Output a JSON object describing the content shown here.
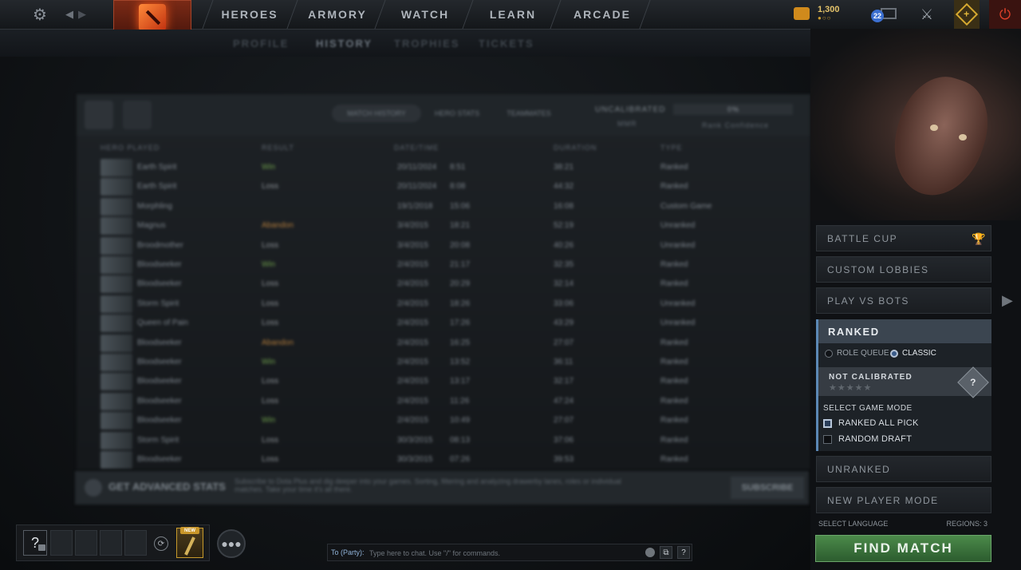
{
  "nav": {
    "items": [
      "HEROES",
      "ARMORY",
      "WATCH",
      "LEARN",
      "ARCADE"
    ]
  },
  "currency": {
    "amount": "1,300",
    "dots": "●○○"
  },
  "notifications": {
    "count": "22"
  },
  "subnav": {
    "items": [
      "PROFILE",
      "HISTORY",
      "TROPHIES",
      "TICKETS"
    ],
    "active": "HISTORY"
  },
  "profile": {
    "tabs": [
      "MATCH HISTORY",
      "HERO STATS",
      "TEAMMATES"
    ],
    "rank_label": "UNCALIBRATED",
    "rank_sub": "MMR",
    "confidence_label": "Rank Confidence",
    "confidence_value": "0%",
    "columns": [
      "HERO PLAYED",
      "RESULT",
      "DATE/TIME",
      "DURATION",
      "TYPE"
    ],
    "matches": [
      {
        "hero": "Earth Spirit",
        "result": "Win",
        "date": "20/11/2024",
        "time": "8:51",
        "duration": "38:21",
        "type": "Ranked"
      },
      {
        "hero": "Earth Spirit",
        "result": "Loss",
        "date": "20/11/2024",
        "time": "8:08",
        "duration": "44:32",
        "type": "Ranked"
      },
      {
        "hero": "Morphling",
        "result": "",
        "date": "19/1/2018",
        "time": "15:06",
        "duration": "16:08",
        "type": "Custom Game"
      },
      {
        "hero": "Magnus",
        "result": "Abandon",
        "date": "3/4/2015",
        "time": "18:21",
        "duration": "52:19",
        "type": "Unranked"
      },
      {
        "hero": "Broodmother",
        "result": "Loss",
        "date": "3/4/2015",
        "time": "20:08",
        "duration": "40:26",
        "type": "Unranked"
      },
      {
        "hero": "Bloodseeker",
        "result": "Win",
        "date": "2/4/2015",
        "time": "21:17",
        "duration": "32:35",
        "type": "Ranked"
      },
      {
        "hero": "Bloodseeker",
        "result": "Loss",
        "date": "2/4/2015",
        "time": "20:29",
        "duration": "32:14",
        "type": "Ranked"
      },
      {
        "hero": "Storm Spirit",
        "result": "Loss",
        "date": "2/4/2015",
        "time": "18:26",
        "duration": "33:06",
        "type": "Unranked"
      },
      {
        "hero": "Queen of Pain",
        "result": "Loss",
        "date": "2/4/2015",
        "time": "17:26",
        "duration": "43:29",
        "type": "Unranked"
      },
      {
        "hero": "Bloodseeker",
        "result": "Abandon",
        "date": "2/4/2015",
        "time": "16:25",
        "duration": "27:07",
        "type": "Ranked"
      },
      {
        "hero": "Bloodseeker",
        "result": "Win",
        "date": "2/4/2015",
        "time": "13:52",
        "duration": "36:11",
        "type": "Ranked"
      },
      {
        "hero": "Bloodseeker",
        "result": "Loss",
        "date": "2/4/2015",
        "time": "13:17",
        "duration": "32:17",
        "type": "Ranked"
      },
      {
        "hero": "Bloodseeker",
        "result": "Loss",
        "date": "2/4/2015",
        "time": "11:26",
        "duration": "47:24",
        "type": "Ranked"
      },
      {
        "hero": "Bloodseeker",
        "result": "Win",
        "date": "2/4/2015",
        "time": "10:49",
        "duration": "27:07",
        "type": "Ranked"
      },
      {
        "hero": "Storm Spirit",
        "result": "Loss",
        "date": "30/3/2015",
        "time": "08:13",
        "duration": "37:06",
        "type": "Ranked"
      },
      {
        "hero": "Bloodseeker",
        "result": "Loss",
        "date": "30/3/2015",
        "time": "07:26",
        "duration": "39:53",
        "type": "Ranked"
      }
    ]
  },
  "advanced": {
    "title": "GET ADVANCED STATS",
    "body": "Subscribe to Dota Plus and dig deeper into your games. Sorting, filtering and analyzing drawerby lanes, roles or individual matches. Take your time it's all there.",
    "button": "SUBSCRIBE"
  },
  "play_menu": {
    "battle_cup": "BATTLE CUP",
    "custom_lobbies": "CUSTOM LOBBIES",
    "play_vs_bots": "PLAY VS BOTS",
    "ranked": {
      "title": "RANKED",
      "queue_options": [
        "ROLE QUEUE",
        "CLASSIC"
      ],
      "queue_selected": "CLASSIC",
      "calibration": "NOT CALIBRATED",
      "stars": "★★★★★",
      "medal": "?",
      "select_mode_label": "SELECT GAME MODE",
      "modes": [
        {
          "label": "RANKED ALL PICK",
          "checked": true
        },
        {
          "label": "RANDOM DRAFT",
          "checked": false
        }
      ]
    },
    "unranked": "UNRANKED",
    "new_player_mode": "NEW PLAYER MODE",
    "select_language": "SELECT LANGUAGE",
    "regions": "REGIONS: 3",
    "find_match": "FIND MATCH"
  },
  "party": {
    "help": "?",
    "new_badge": "NEW"
  },
  "chat": {
    "to_label": "To (Party):",
    "placeholder": "Type here to chat. Use \"/\" for commands.",
    "help": "?"
  },
  "colors": {
    "accent_green": "#4c8a4a",
    "ranked_header": "#3b4550",
    "gold": "#d4a92c",
    "power_red": "#e0402a"
  },
  "icons": [
    "gear-icon",
    "back-arrow-icon",
    "forward-arrow-icon",
    "dota-logo-icon",
    "gold-coin-icon",
    "mail-icon",
    "armory-icon",
    "plus-icon",
    "power-icon",
    "trophy-icon",
    "play-arrow-icon",
    "medal-icon",
    "lock-icon",
    "invite-icon",
    "friends-icon",
    "emoji-icon",
    "chat-settings-icon"
  ]
}
